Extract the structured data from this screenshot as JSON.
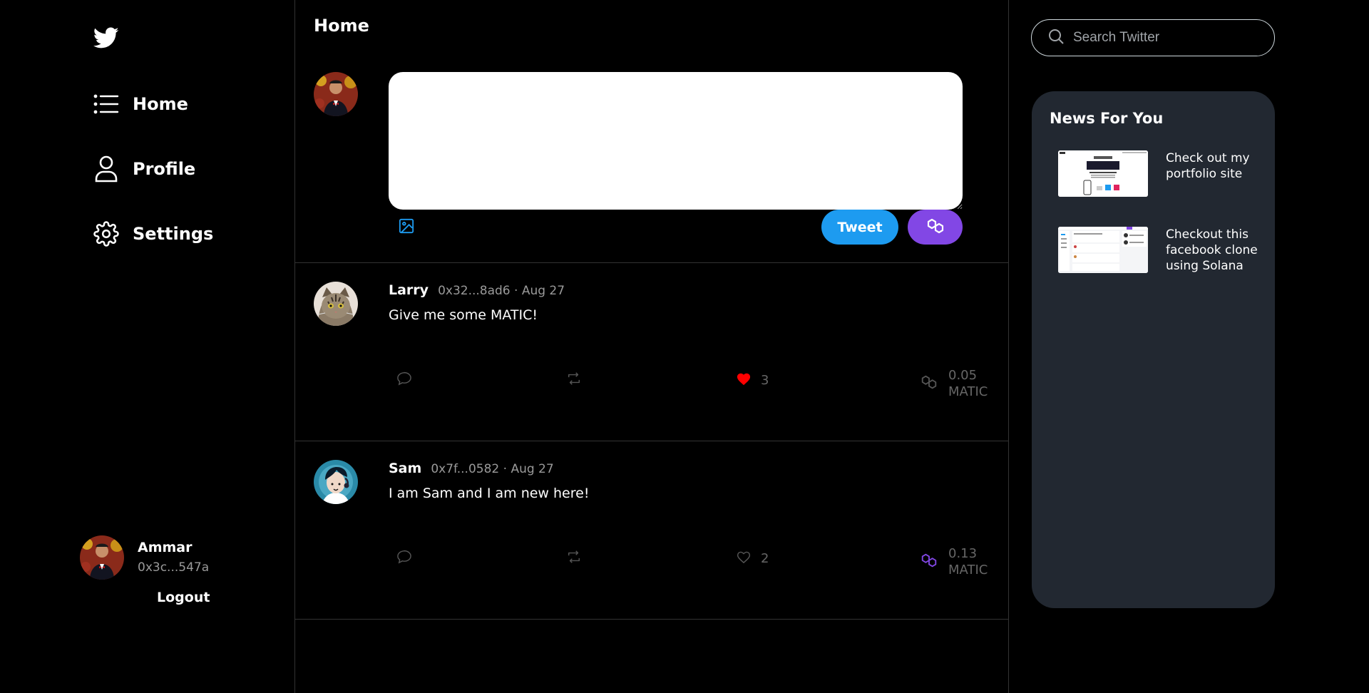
{
  "sidebar": {
    "logo": "twitter-bird",
    "nav": [
      {
        "label": "Home",
        "icon": "list-icon"
      },
      {
        "label": "Profile",
        "icon": "user-icon"
      },
      {
        "label": "Settings",
        "icon": "gear-icon"
      }
    ],
    "user": {
      "name": "Ammar",
      "address": "0x3c...547a",
      "logout_label": "Logout"
    }
  },
  "feed": {
    "title": "Home",
    "composer": {
      "value": "",
      "tweet_label": "Tweet"
    },
    "posts": [
      {
        "author": "Larry",
        "handle": "0x32...8ad6 · Aug 27",
        "text": "Give me some MATIC!",
        "likes": "3",
        "liked": true,
        "tip_amount": "0.05",
        "tip_unit": "MATIC"
      },
      {
        "author": "Sam",
        "handle": "0x7f...0582 · Aug 27",
        "text": "I am Sam and I am new here!",
        "likes": "2",
        "liked": false,
        "tip_amount": "0.13",
        "tip_unit": "MATIC"
      }
    ]
  },
  "right": {
    "search": {
      "placeholder": "Search Twitter"
    },
    "news": {
      "title": "News For You",
      "items": [
        {
          "text": "Check out my portfolio site"
        },
        {
          "text": "Checkout this facebook clone using Solana"
        }
      ]
    }
  },
  "colors": {
    "accent": "#1d9bf0",
    "matic": "#8247e5",
    "like": "#ff0000",
    "panel": "#222831"
  }
}
